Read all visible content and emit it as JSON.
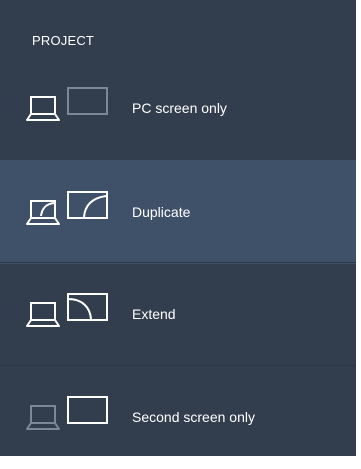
{
  "panel": {
    "title": "PROJECT",
    "options": [
      {
        "label": "PC screen only",
        "icon": "pc-screen-only-icon",
        "selected": false
      },
      {
        "label": "Duplicate",
        "icon": "duplicate-icon",
        "selected": true
      },
      {
        "label": "Extend",
        "icon": "extend-icon",
        "selected": false
      },
      {
        "label": "Second screen only",
        "icon": "second-screen-only-icon",
        "selected": false
      }
    ]
  },
  "colors": {
    "panel_background": "#323d4d",
    "selected_background": "#3f5069",
    "icon_active": "#ffffff",
    "icon_dimmed": "#7d8796"
  }
}
